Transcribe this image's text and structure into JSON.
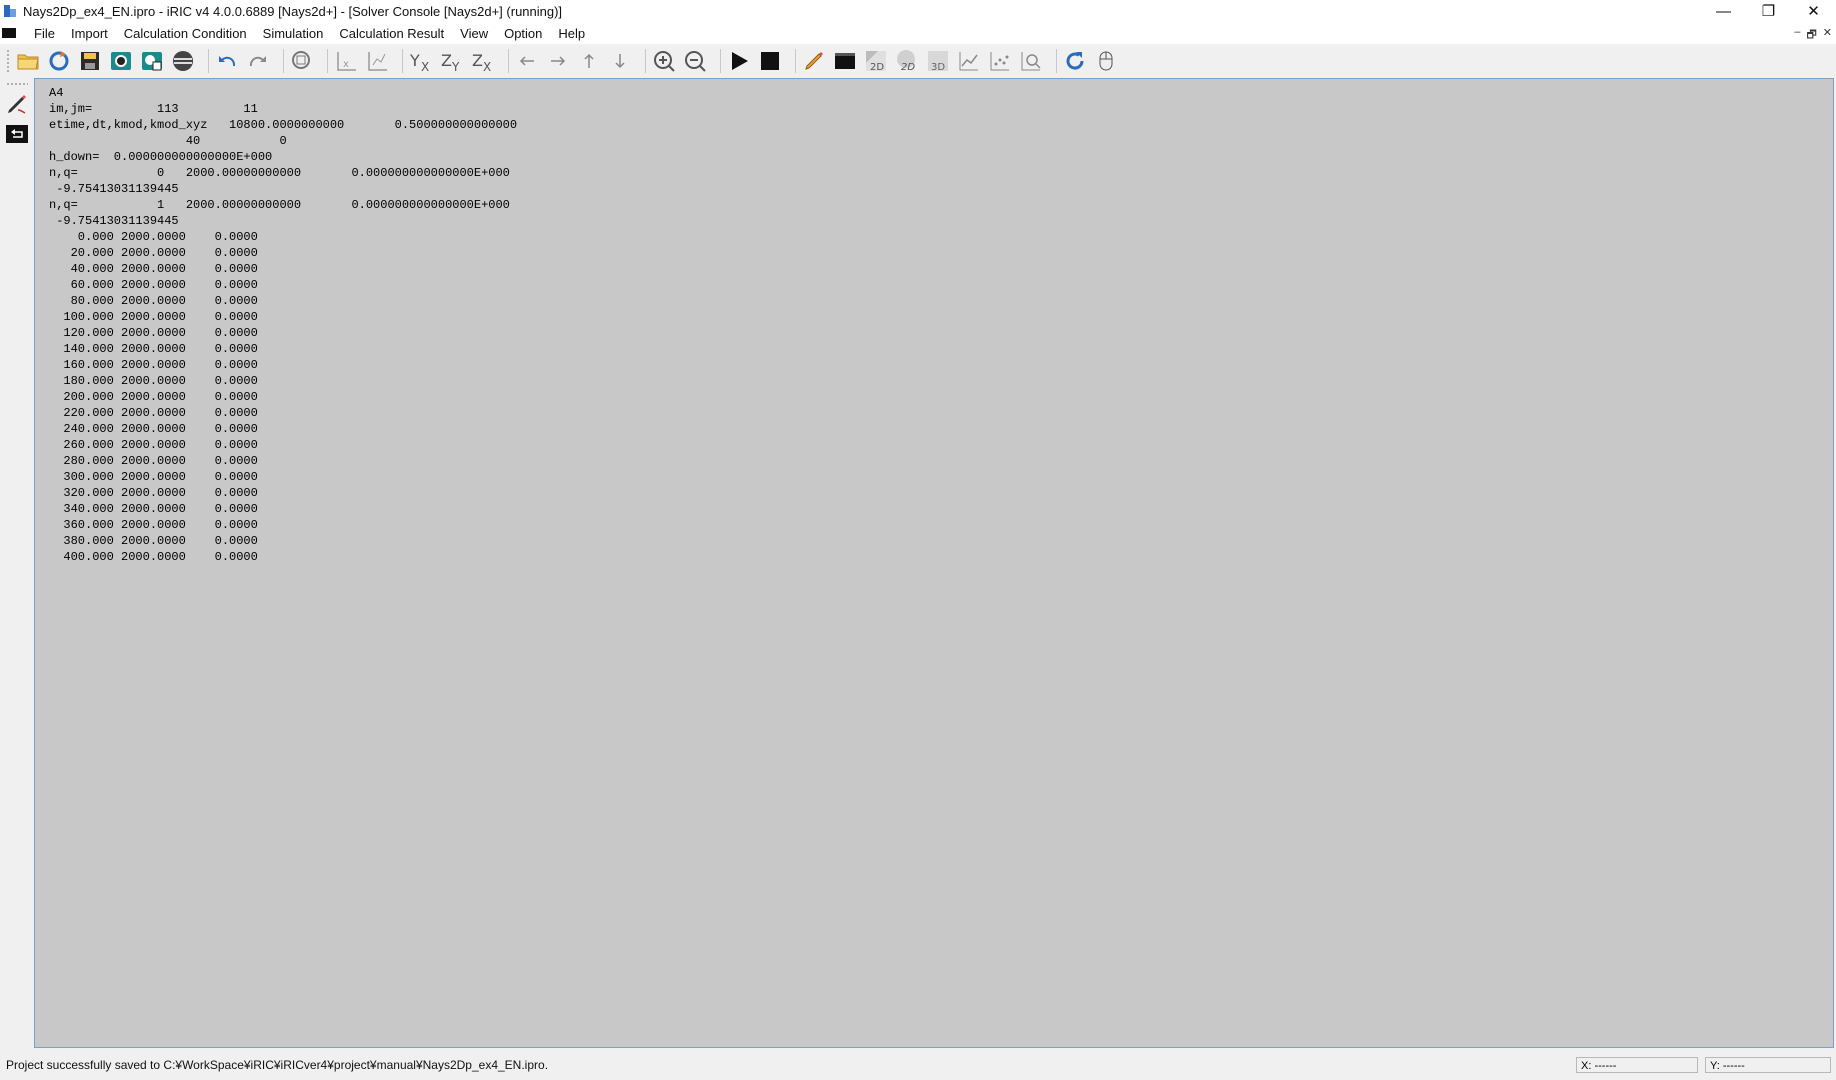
{
  "window": {
    "title": "Nays2Dp_ex4_EN.ipro - iRIC v4 4.0.0.6889 [Nays2d+] - [Solver Console [Nays2d+] (running)]",
    "controls": [
      "—",
      "❐",
      "✕"
    ]
  },
  "menu": {
    "items": [
      "File",
      "Import",
      "Calculation Condition",
      "Simulation",
      "Calculation Result",
      "View",
      "Option",
      "Help"
    ],
    "mdi_controls": [
      "–",
      "🗗",
      "✕"
    ]
  },
  "toolbar": {
    "icons": [
      "open-project-icon",
      "reload-icon",
      "save-icon",
      "camera-icon",
      "snapshot-icon",
      "ball-icon",
      "undo-icon",
      "redo-icon",
      "zoom-fit-icon",
      "axis-x-icon",
      "axis-xy-icon",
      "view-yx-icon",
      "view-zy-icon",
      "view-zx-icon",
      "arrow-left-icon",
      "arrow-right-icon",
      "arrow-up-icon",
      "arrow-down-icon",
      "zoom-in-icon",
      "zoom-out-icon",
      "run-icon",
      "stop-icon",
      "edit-icon",
      "console-icon",
      "2d-icon",
      "2d-bird-icon",
      "3d-icon",
      "graph-icon",
      "scatter-icon",
      "zoom-window-icon",
      "refresh-icon",
      "mouse-icon"
    ],
    "labels": {
      "yx": "YX",
      "zy": "ZY",
      "zx": "ZX",
      "twod": "2D",
      "twod_bird": "2D",
      "threed": "3D"
    }
  },
  "console": {
    "lines": [
      "A4",
      "im,jm=         113         11",
      "etime,dt,kmod,kmod_xyz   10800.0000000000       0.500000000000000",
      "                   40           0",
      "h_down=  0.000000000000000E+000",
      "n,q=           0   2000.00000000000       0.000000000000000E+000",
      " -9.75413031139445",
      "n,q=           1   2000.00000000000       0.000000000000000E+000",
      " -9.75413031139445",
      "    0.000 2000.0000    0.0000",
      "   20.000 2000.0000    0.0000",
      "   40.000 2000.0000    0.0000",
      "   60.000 2000.0000    0.0000",
      "   80.000 2000.0000    0.0000",
      "  100.000 2000.0000    0.0000",
      "  120.000 2000.0000    0.0000",
      "  140.000 2000.0000    0.0000",
      "  160.000 2000.0000    0.0000",
      "  180.000 2000.0000    0.0000",
      "  200.000 2000.0000    0.0000",
      "  220.000 2000.0000    0.0000",
      "  240.000 2000.0000    0.0000",
      "  260.000 2000.0000    0.0000",
      "  280.000 2000.0000    0.0000",
      "  300.000 2000.0000    0.0000",
      "  320.000 2000.0000    0.0000",
      "  340.000 2000.0000    0.0000",
      "  360.000 2000.0000    0.0000",
      "  380.000 2000.0000    0.0000",
      "  400.000 2000.0000    0.0000"
    ]
  },
  "statusbar": {
    "message": "Project successfully saved to C:¥WorkSpace¥iRIC¥iRICver4¥project¥manual¥Nays2Dp_ex4_EN.ipro.",
    "x_label": "X: ------",
    "y_label": "Y: ------"
  },
  "colors": {
    "console_bg": "#c8c8c8",
    "chrome_bg": "#f0f0f0",
    "accent_blue": "#2a6bbf",
    "teal": "#1a8a8a"
  }
}
